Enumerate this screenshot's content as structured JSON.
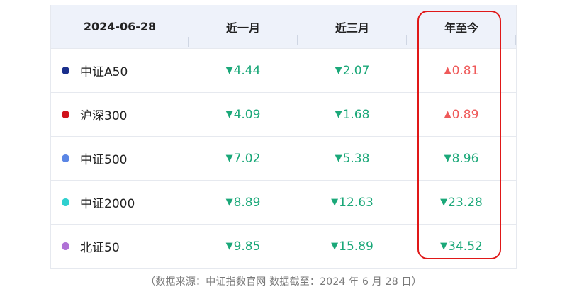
{
  "table": {
    "headers": [
      "2024-06-28",
      "近一月",
      "近三月",
      "年至今"
    ],
    "rows": [
      {
        "name": "中证A50",
        "dot_color": "#1a2f8c",
        "m1": {
          "dir": "down",
          "arrow": "▼",
          "value": "4.44"
        },
        "m3": {
          "dir": "down",
          "arrow": "▼",
          "value": "2.07"
        },
        "ytd": {
          "dir": "up",
          "arrow": "▲",
          "value": "0.81"
        }
      },
      {
        "name": "沪深300",
        "dot_color": "#d0121b",
        "m1": {
          "dir": "down",
          "arrow": "▼",
          "value": "4.09"
        },
        "m3": {
          "dir": "down",
          "arrow": "▼",
          "value": "1.68"
        },
        "ytd": {
          "dir": "up",
          "arrow": "▲",
          "value": "0.89"
        }
      },
      {
        "name": "中证500",
        "dot_color": "#5b86e5",
        "m1": {
          "dir": "down",
          "arrow": "▼",
          "value": "7.02"
        },
        "m3": {
          "dir": "down",
          "arrow": "▼",
          "value": "5.38"
        },
        "ytd": {
          "dir": "down",
          "arrow": "▼",
          "value": "8.96"
        }
      },
      {
        "name": "中证2000",
        "dot_color": "#2fd0cf",
        "m1": {
          "dir": "down",
          "arrow": "▼",
          "value": "8.89"
        },
        "m3": {
          "dir": "down",
          "arrow": "▼",
          "value": "12.63"
        },
        "ytd": {
          "dir": "down",
          "arrow": "▼",
          "value": "23.28"
        }
      },
      {
        "name": "北证50",
        "dot_color": "#b072d6",
        "m1": {
          "dir": "down",
          "arrow": "▼",
          "value": "9.85"
        },
        "m3": {
          "dir": "down",
          "arrow": "▼",
          "value": "15.89"
        },
        "ytd": {
          "dir": "down",
          "arrow": "▼",
          "value": "34.52"
        }
      }
    ]
  },
  "source_note": "（数据来源：中证指数官网  数据截至：2024 年 6 月 28 日）",
  "colors": {
    "down": "#1ba879",
    "up": "#ef5a5a",
    "highlight": "#e01818",
    "header_bg": "#eef2fa"
  }
}
